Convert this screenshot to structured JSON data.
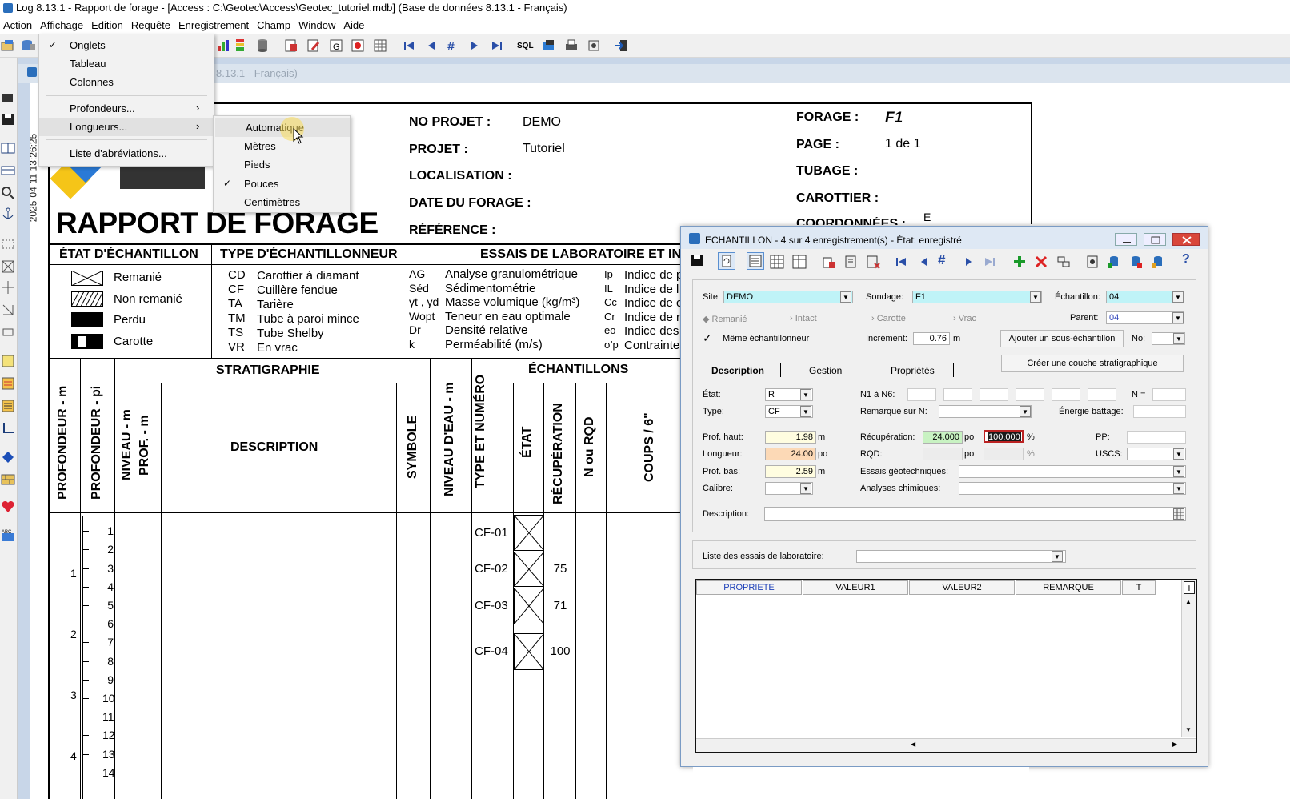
{
  "window": {
    "title": "Log 8.13.1 - Rapport de forage - [Access : C:\\Geotec\\Access\\Geotec_tutoriel.mdb] (Base de données 8.13.1 - Français)",
    "inner_title": "8.13.1 - Français)"
  },
  "menubar": [
    "Action",
    "Affichage",
    "Edition",
    "Requête",
    "Enregistrement",
    "Champ",
    "Window",
    "Aide"
  ],
  "toolbar": {
    "sql_label": "SQL"
  },
  "side_date": "2025-04-11 13:26:25",
  "affichage_menu": {
    "items": [
      {
        "label": "Onglets",
        "checked": true
      },
      {
        "label": "Tableau",
        "checked": false
      },
      {
        "label": "Colonnes",
        "checked": false
      },
      {
        "label": "Profondeurs...",
        "submenu": true
      },
      {
        "label": "Longueurs...",
        "submenu": true
      },
      {
        "label": "Liste d'abréviations..."
      }
    ]
  },
  "longueurs_submenu": {
    "items": [
      {
        "label": "Automatique",
        "checked": false,
        "hovered": true
      },
      {
        "label": "Mètres",
        "checked": false
      },
      {
        "label": "Pieds",
        "checked": false
      },
      {
        "label": "Pouces",
        "checked": true
      },
      {
        "label": "Centimètres",
        "checked": false
      }
    ]
  },
  "report": {
    "title": "RAPPORT DE FORAGE",
    "no_projet_label": "NO PROJET :",
    "no_projet": "DEMO",
    "projet_label": "PROJET :",
    "projet": "Tutoriel",
    "localisation_label": "LOCALISATION :",
    "date_label": "DATE DU FORAGE :",
    "reference_label": "RÉFÉRENCE :",
    "forage_label": "FORAGE :",
    "forage": "F1",
    "page_label": "PAGE :",
    "page": "1 de 1",
    "tubage_label": "TUBAGE :",
    "carottier_label": "CAROTTIER :",
    "coord_label": "COORDONNÉES :",
    "coord_partial": "E",
    "etat_head": "ÉTAT D'ÉCHANTILLON",
    "etat_items": [
      "Remanié",
      "Non remanié",
      "Perdu",
      "Carotte"
    ],
    "type_head": "TYPE D'ÉCHANTILLONNEUR",
    "type_items": [
      {
        "code": "CD",
        "label": "Carottier à diamant"
      },
      {
        "code": "CF",
        "label": "Cuillère fendue"
      },
      {
        "code": "TA",
        "label": "Tarière"
      },
      {
        "code": "TM",
        "label": "Tube à paroi mince"
      },
      {
        "code": "TS",
        "label": "Tube Shelby"
      },
      {
        "code": "VR",
        "label": "En vrac"
      }
    ],
    "essais_head": "ESSAIS DE LABORATOIRE ET IN",
    "essais_items": [
      {
        "code": "AG",
        "label": "Analyse granulométrique"
      },
      {
        "code": "Séd",
        "label": "Sédimentométrie"
      },
      {
        "code": "γt , γd",
        "label": "Masse volumique (kg/m³)"
      },
      {
        "code": "Wopt",
        "label": "Teneur en eau optimale"
      },
      {
        "code": "Dr",
        "label": "Densité relative"
      },
      {
        "code": "k",
        "label": "Perméabilité (m/s)"
      }
    ],
    "indices": [
      {
        "code": "Ip",
        "label": "Indice de p"
      },
      {
        "code": "IL",
        "label": "Indice de l"
      },
      {
        "code": "Cc",
        "label": "Indice de c"
      },
      {
        "code": "Cr",
        "label": "Indice de r"
      },
      {
        "code": "eo",
        "label": "Indice des"
      },
      {
        "code": "σ'p",
        "label": "Contrainte"
      }
    ],
    "strat_head": "STRATIGRAPHIE",
    "ech_head": "ÉCHANTILLONS",
    "col_prof_m": "PROFONDEUR - m",
    "col_prof_pi": "PROFONDEUR - pi",
    "col_niveau": "NIVEAU - m",
    "col_prof2": "PROF. - m",
    "col_description": "DESCRIPTION",
    "col_symbole": "SYMBOLE",
    "col_niveau_eau": "NIVEAU D'EAU - m",
    "col_type_num": "TYPE ET NUMÉRO",
    "col_etat": "ÉTAT",
    "col_recup": "RÉCUPÉRATION",
    "col_rqd": "N ou RQD",
    "col_coups": "COUPS / 6\"",
    "depth_m": [
      "1",
      "2",
      "3",
      "4"
    ],
    "depth_pi": [
      "1",
      "2",
      "3",
      "4",
      "5",
      "6",
      "7",
      "8",
      "9",
      "10",
      "11",
      "12",
      "13",
      "14"
    ],
    "samples": [
      {
        "id": "CF-01",
        "recup": ""
      },
      {
        "id": "CF-02",
        "recup": "75"
      },
      {
        "id": "CF-03",
        "recup": "71"
      },
      {
        "id": "CF-04",
        "recup": "100"
      }
    ]
  },
  "dialog": {
    "title": "ECHANTILLON - 4 sur 4 enregistrement(s) - État: enregistré",
    "site_label": "Site:",
    "site": "DEMO",
    "sondage_label": "Sondage:",
    "sondage": "F1",
    "echantillon_label": "Échantillon:",
    "echantillon": "04",
    "parent_label": "Parent:",
    "parent": "04",
    "nav_items": [
      "Remanié",
      "Intact",
      "Carotté",
      "Vrac"
    ],
    "meme_label": "Même échantillonneur",
    "increment_label": "Incrément:",
    "increment": "0.76",
    "increment_unit": "m",
    "add_sub_button": "Ajouter un sous-échantillon",
    "no_label": "No:",
    "tabs": [
      "Description",
      "Gestion",
      "Propriétés"
    ],
    "create_layer_button": "Créer une couche stratigraphique",
    "etat_label": "État:",
    "etat": "R",
    "type_label": "Type:",
    "type": "CF",
    "n1n6_label": "N1 à N6:",
    "n_label": "N =",
    "remarque_n_label": "Remarque sur N:",
    "energie_label": "Énergie battage:",
    "prof_haut_label": "Prof. haut:",
    "prof_haut": "1.98",
    "prof_haut_unit": "m",
    "longueur_label": "Longueur:",
    "longueur": "24.00",
    "longueur_unit": "po",
    "prof_bas_label": "Prof. bas:",
    "prof_bas": "2.59",
    "prof_bas_unit": "m",
    "calibre_label": "Calibre:",
    "recup_label": "Récupération:",
    "recup": "24.000",
    "recup_unit": "po",
    "recup_pct": "100.000",
    "pct": "%",
    "rqd_label": "RQD:",
    "rqd_unit": "po",
    "rqd_pct": "%",
    "pp_label": "PP:",
    "uscs_label": "USCS:",
    "essais_geo_label": "Essais géotechniques:",
    "analyses_label": "Analyses chimiques:",
    "description_label": "Description:",
    "liste_essais_label": "Liste des essais de laboratoire:",
    "grid_headers": [
      "PROPRIETE",
      "VALEUR1",
      "VALEUR2",
      "REMARQUE",
      "T"
    ],
    "colors": {
      "site_bg": "#bff3f7",
      "longueur_bg": "#fcd9b6",
      "recup_bg": "#c8f2c2",
      "prof_bg": "#fffde0"
    }
  }
}
